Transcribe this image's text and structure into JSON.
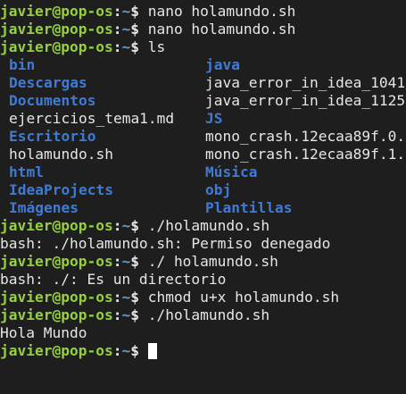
{
  "prompt": {
    "user_host": "javier@pop-os",
    "colon": ":",
    "path": "~",
    "symbol": "$"
  },
  "colors": {
    "background": "#1e1e1e",
    "prompt_user": "#94d13b",
    "prompt_path": "#5f9bd6",
    "directory": "#3f7bd4",
    "text": "#e6e6e6"
  },
  "session": {
    "cmd1": "nano holamundo.sh",
    "cmd2": "nano holamundo.sh",
    "cmd3": "ls",
    "ls": [
      {
        "left": "bin",
        "left_type": "dir",
        "right": "java",
        "right_type": "dir"
      },
      {
        "left": "Descargas",
        "left_type": "dir",
        "right": "java_error_in_idea_1041",
        "right_type": "file"
      },
      {
        "left": "Documentos",
        "left_type": "dir",
        "right": "java_error_in_idea_1125",
        "right_type": "file"
      },
      {
        "left": "ejercicios_tema1.md",
        "left_type": "file",
        "right": "JS",
        "right_type": "dir"
      },
      {
        "left": "Escritorio",
        "left_type": "dir",
        "right": "mono_crash.12ecaa89f.0.",
        "right_type": "file"
      },
      {
        "left": "holamundo.sh",
        "left_type": "file",
        "right": "mono_crash.12ecaa89f.1.",
        "right_type": "file"
      },
      {
        "left": "html",
        "left_type": "dir",
        "right": "Música",
        "right_type": "dir"
      },
      {
        "left": "IdeaProjects",
        "left_type": "dir",
        "right": "obj",
        "right_type": "dir"
      },
      {
        "left": "Imágenes",
        "left_type": "dir",
        "right": "Plantillas",
        "right_type": "dir"
      }
    ],
    "cmd4": "./holamundo.sh",
    "out4": "bash: ./holamundo.sh: Permiso denegado",
    "cmd5": "./ holamundo.sh",
    "out5": "bash: ./: Es un directorio",
    "cmd6": "chmod u+x holamundo.sh",
    "cmd7": "./holamundo.sh",
    "out7": "Hola Mundo",
    "cursor_icon": "block-cursor-icon"
  }
}
